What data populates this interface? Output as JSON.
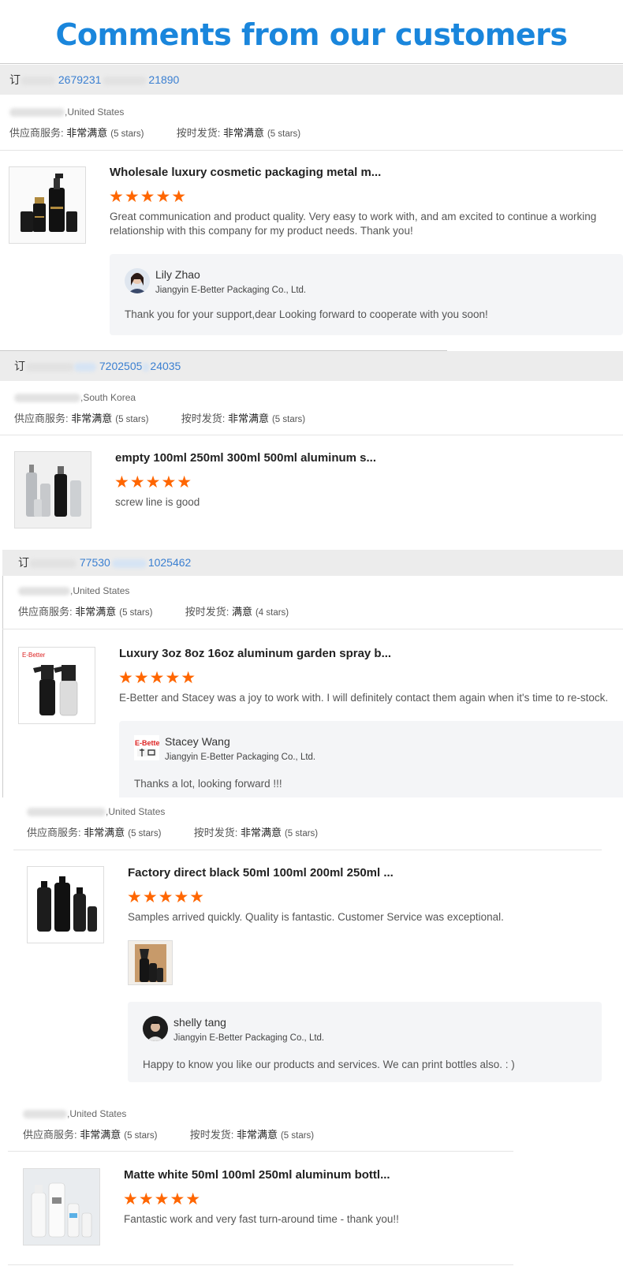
{
  "page_title": "Comments from our customers",
  "colors": {
    "title": "#1a86dc",
    "stars": "#ff6600",
    "order_number": "#3a7fd1"
  },
  "labels": {
    "supplier_service": "供应商服务:",
    "on_time": "按时发货:",
    "very_satisfied": "非常满意",
    "satisfied": "满意",
    "five_stars": "(5 stars)",
    "four_stars": "(4 stars)",
    "stars_glyph": "★★★★★"
  },
  "reviews": [
    {
      "order_prefix": "订",
      "order_num_a": "2679231",
      "order_num_b": "21890",
      "country": ",United States",
      "supplier_rating": "非常满意",
      "supplier_stars": "(5 stars)",
      "ontime_rating": "非常满意",
      "ontime_stars": "(5 stars)",
      "product_title": "Wholesale luxury cosmetic packaging metal m...",
      "rating": 5,
      "comment": "Great communication and product quality. Very easy to work with, and am excited to continue a working relationship with this company for my product needs. Thank you!",
      "reply": {
        "name": "Lily Zhao",
        "company": "Jiangyin E-Better Packaging Co., Ltd.",
        "text": "Thank you for your support,dear Looking forward to cooperate with you soon!"
      }
    },
    {
      "order_prefix": "订",
      "order_num_a": "7202505",
      "order_num_b": "24035",
      "country": ",South Korea",
      "supplier_rating": "非常满意",
      "supplier_stars": "(5 stars)",
      "ontime_rating": "非常满意",
      "ontime_stars": "(5 stars)",
      "product_title": "empty 100ml 250ml 300ml 500ml aluminum s...",
      "rating": 5,
      "comment": "screw line is good"
    },
    {
      "order_prefix": "订",
      "order_num_a": "77530",
      "order_num_b": "1025462",
      "country": ",United States",
      "supplier_rating": "非常满意",
      "supplier_stars": "(5 stars)",
      "ontime_rating": "满意",
      "ontime_stars": "(4 stars)",
      "product_title": "Luxury 3oz 8oz 16oz aluminum garden spray b...",
      "rating": 5,
      "comment": "E-Better and Stacey was a joy to work with.  I will definitely contact them again when it's time to re-stock.",
      "reply": {
        "name": "Stacey Wang",
        "company": "Jiangyin E-Better Packaging Co., Ltd.",
        "text": "Thanks a lot, looking forward !!!",
        "logo_text": "E-Better"
      }
    },
    {
      "country": ",United States",
      "supplier_rating": "非常满意",
      "supplier_stars": "(5 stars)",
      "ontime_rating": "非常满意",
      "ontime_stars": "(5 stars)",
      "product_title": "Factory direct black 50ml 100ml 200ml 250ml ...",
      "rating": 5,
      "comment": "Samples arrived quickly. Quality is fantastic. Customer Service was exceptional.",
      "reply": {
        "name": "shelly tang",
        "company": "Jiangyin E-Better Packaging Co., Ltd.",
        "text": "Happy to know you like our products and services. We can print bottles also. : )"
      }
    },
    {
      "country": ",United States",
      "supplier_rating": "非常满意",
      "supplier_stars": "(5 stars)",
      "ontime_rating": "非常满意",
      "ontime_stars": "(5 stars)",
      "product_title": "Matte white 50ml 100ml 250ml aluminum bottl...",
      "rating": 5,
      "comment": "Fantastic work and very fast turn-around time - thank you!!"
    }
  ]
}
